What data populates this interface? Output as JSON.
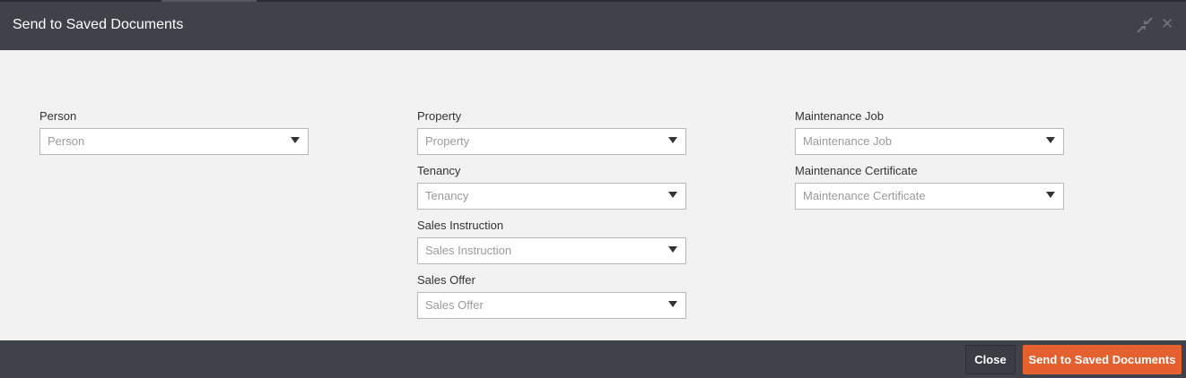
{
  "dialog": {
    "title": "Send to Saved Documents",
    "icons": [
      "collapse-icon",
      "close-icon"
    ]
  },
  "fields": {
    "person": {
      "label": "Person",
      "placeholder": "Person"
    },
    "property": {
      "label": "Property",
      "placeholder": "Property"
    },
    "tenancy": {
      "label": "Tenancy",
      "placeholder": "Tenancy"
    },
    "sales_instruction": {
      "label": "Sales Instruction",
      "placeholder": "Sales Instruction"
    },
    "sales_offer": {
      "label": "Sales Offer",
      "placeholder": "Sales Offer"
    },
    "maintenance_job": {
      "label": "Maintenance Job",
      "placeholder": "Maintenance Job"
    },
    "maintenance_certificate": {
      "label": "Maintenance Certificate",
      "placeholder": "Maintenance Certificate"
    }
  },
  "footer": {
    "close_label": "Close",
    "send_label": "Send to Saved Documents"
  },
  "colors": {
    "header_bg": "#3f4249",
    "content_bg": "#f2f2f2",
    "accent": "#e5602f"
  }
}
